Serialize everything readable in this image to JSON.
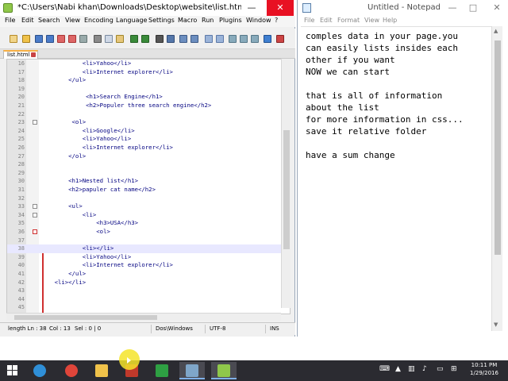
{
  "notepad_pp": {
    "title": "*C:\\Users\\Nabi khan\\Downloads\\Desktop\\website\\list.html - Notepad++",
    "min_glyph": "—",
    "close_glyph": "✕",
    "menu": [
      "File",
      "Edit",
      "Search",
      "View",
      "Encoding",
      "Language",
      "Settings",
      "Macro",
      "Run",
      "Plugins",
      "Window",
      "?"
    ],
    "tab_label": "list.html",
    "lines": [
      {
        "num": "16",
        "text": "            <li>Yahoo</li>"
      },
      {
        "num": "17",
        "text": "            <li>Internet explorer</li>"
      },
      {
        "num": "18",
        "text": "        </ul>"
      },
      {
        "num": "19",
        "text": ""
      },
      {
        "num": "20",
        "text": "             <h1>Search Engine</h1>"
      },
      {
        "num": "21",
        "text": "             <h2>Populer three search engine</h2>"
      },
      {
        "num": "22",
        "text": ""
      },
      {
        "num": "23",
        "text": "         <ol>"
      },
      {
        "num": "24",
        "text": "            <li>Google</li>"
      },
      {
        "num": "25",
        "text": "            <li>Yahoo</li>"
      },
      {
        "num": "26",
        "text": "            <li>Internet explorer</li>"
      },
      {
        "num": "27",
        "text": "        </ol>"
      },
      {
        "num": "28",
        "text": ""
      },
      {
        "num": "29",
        "text": ""
      },
      {
        "num": "30",
        "text": "        <h1>Nested list</h1>"
      },
      {
        "num": "31",
        "text": "        <h2>papuler cat name</h2>"
      },
      {
        "num": "32",
        "text": ""
      },
      {
        "num": "33",
        "text": "        <ul>"
      },
      {
        "num": "34",
        "text": "            <li>"
      },
      {
        "num": "35",
        "text": "                <h3>USA</h3>"
      },
      {
        "num": "36",
        "text": "                <ol>"
      },
      {
        "num": "37",
        "text": ""
      },
      {
        "num": "38",
        "text": "            <li></li>"
      },
      {
        "num": "39",
        "text": "            <li>Yahoo</li>"
      },
      {
        "num": "40",
        "text": "            <li>Internet explorer</li>"
      },
      {
        "num": "41",
        "text": "        </ul>"
      },
      {
        "num": "42",
        "text": "    <li></li>"
      },
      {
        "num": "43",
        "text": ""
      },
      {
        "num": "44",
        "text": ""
      },
      {
        "num": "45",
        "text": ""
      }
    ],
    "status": {
      "length": "length Ln : 38",
      "col": "Col : 13",
      "sel": "Sel : 0 | 0",
      "eol": "Dos\\Windows",
      "encoding": "UTF-8",
      "mode": "INS"
    }
  },
  "notepad": {
    "title": "Untitled - Notepad",
    "min_glyph": "—",
    "max_glyph": "□",
    "close_glyph": "✕",
    "menu": [
      "File",
      "Edit",
      "Format",
      "View",
      "Help"
    ],
    "lines": [
      "comples data in your page.you",
      "can easily lists insides each",
      "other if you want",
      "NOW we can start",
      "",
      "that is all of information",
      "about the list",
      "for more information in css...",
      "save it relative folder",
      "",
      "have a sum change"
    ]
  },
  "taskbar": {
    "items": [
      {
        "name": "start-button",
        "icon": "windows-logo-icon"
      },
      {
        "name": "internet-explorer-button",
        "icon": "internet-explorer-icon",
        "color": "#2f8fd8"
      },
      {
        "name": "chrome-button",
        "icon": "chrome-icon",
        "color": "#e0453a"
      },
      {
        "name": "file-explorer-button",
        "icon": "folder-icon",
        "color": "#f0c24a"
      },
      {
        "name": "media-button",
        "icon": "media-icon",
        "color": "#c0392b"
      },
      {
        "name": "store-button",
        "icon": "store-icon",
        "color": "#2ea043"
      },
      {
        "name": "notepad-taskbar-button",
        "icon": "notepad-icon",
        "color": "#7fa6c9"
      },
      {
        "name": "notepadpp-taskbar-button",
        "icon": "notepadpp-icon",
        "color": "#8fc74a"
      }
    ],
    "time": "10:11 PM",
    "date": "1/29/2016"
  }
}
